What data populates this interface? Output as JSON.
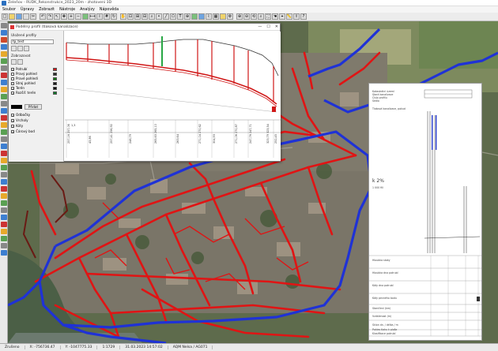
{
  "window": {
    "title": "Zeleňov - RUDK_Rekonstrukce_2023_20m - zhotoveni 3D",
    "menu": [
      "Soubor",
      "Úpravy",
      "Zobrazit",
      "Nástroje",
      "Analýzy",
      "Nápověda"
    ]
  },
  "profile_window": {
    "title": "Podélný profil (tlaková kanalizace)",
    "controls": {
      "minimize": "—",
      "maximize": "☐",
      "close": "✕"
    },
    "saved_profiles_label": "Uložené profily",
    "saved_profile_value": "tp_test",
    "display_label": "Zobrazovat",
    "layers": [
      {
        "label": "Potrubí",
        "checked": true,
        "color": "#d01818"
      },
      {
        "label": "Pravý pohled",
        "checked": false,
        "color": "#2a2a2a"
      },
      {
        "label": "Pravé pohledí",
        "checked": false,
        "color": "#117711"
      },
      {
        "label": "Stroj pohled",
        "checked": false,
        "color": "#1a1a1a"
      },
      {
        "label": "Terén",
        "checked": true,
        "color": "#111111"
      },
      {
        "label": "Rozšíř. terén",
        "checked": true,
        "color": "#0d7d2a"
      }
    ],
    "fill_button": "Přidat",
    "options": [
      {
        "label": "Odbočky",
        "checked": true
      },
      {
        "label": "Vrcholy",
        "checked": true
      },
      {
        "label": "Kóty",
        "checked": true
      },
      {
        "label": "Čárový bod",
        "checked": true
      }
    ],
    "elevation_readouts": [
      "257,16 257,06",
      "43,86",
      "257,41 256,92",
      "248,79",
      "265,63 265,10",
      "263,64",
      "271,04 270,62",
      "304,93",
      "271,06 270,87",
      "247,76 247,71",
      "323,79 323,54",
      "252,45"
    ],
    "station_label": "1,3"
  },
  "document": {
    "rows": [
      "Katastrální území",
      "Stará kanalizace",
      "Číslo profilu",
      "Sedlo",
      "Tlaková kanalizace, pokud",
      "k 2%",
      "1 000 fill",
      "Hloubka stoky",
      "Hloubka dna potrubí",
      "Kóty dna potrubí",
      "Kóty pevného bodu",
      "Staničení (km)",
      "Vzdálenost (m)",
      "Sklon dn. / délka / m",
      "Pokles tlaku k ploše",
      "Klasifikace potrubí"
    ]
  },
  "status": {
    "mode": "Zrušeno",
    "x": "X: -756736.47",
    "y": "Y: -1047775.33",
    "scale": "1:1729",
    "datetime": "31.03.2023 14:57:02",
    "system": "AQM Nelsa / AG071"
  }
}
